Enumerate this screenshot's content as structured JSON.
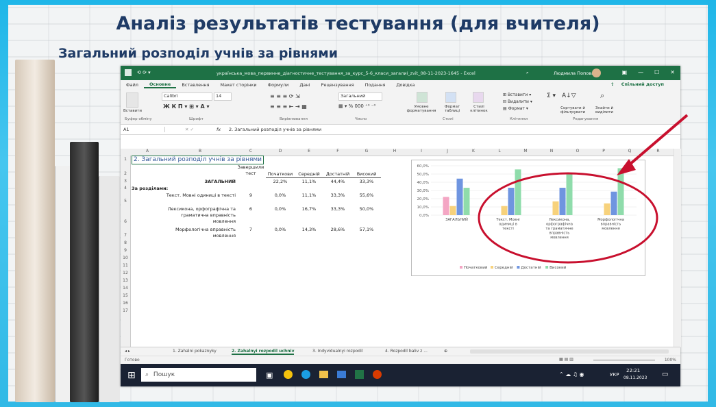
{
  "slide": {
    "title": "Аналіз результатів тестування (для вчителя)",
    "subtitle": "Загальний розподіл учнів за рівнями"
  },
  "excel": {
    "filename": "українська_мова_первинне_діагностичне_тестування_за_курс_5-6_класи_загалиі_zvit_08-11-2023-1645 - Excel",
    "user": "Людмила Попова",
    "menu": [
      "Файл",
      "Основне",
      "Вставлення",
      "Макет сторінки",
      "Формули",
      "Дані",
      "Рецензування",
      "Подання",
      "Довідка"
    ],
    "active_menu": "Основне",
    "share_label": "Спільний доступ",
    "ribbon": {
      "paste": "Вставити",
      "clipboard": "Буфер обміну",
      "font_name": "Calibri",
      "font_size": "14",
      "font_group": "Шрифт",
      "align_group": "Вирівнювання",
      "number_format": "Загальний",
      "number_group": "Число",
      "cond_format": "Умовне форматування",
      "format_table": "Формат таблиці",
      "cell_styles": "Стилі клітинок",
      "styles_group": "Стилі",
      "insert": "Вставити",
      "delete": "Видалити",
      "format": "Формат",
      "cells_group": "Клітинки",
      "sort": "Сортувати й фільтрувати",
      "find": "Знайти й виділити",
      "edit_group": "Редагування"
    },
    "namebox": "A1",
    "formula": "2. Загальний розподіл учнів за рівнями",
    "columns": [
      "A",
      "B",
      "C",
      "D",
      "E",
      "F",
      "G",
      "H",
      "I",
      "J",
      "K",
      "L",
      "M",
      "N",
      "O",
      "P",
      "Q",
      "R"
    ],
    "rows": [
      "1",
      "2",
      "3",
      "4",
      "5",
      "6",
      "7",
      "8",
      "9",
      "10",
      "11",
      "12",
      "13",
      "14",
      "15",
      "16",
      "17"
    ],
    "table": {
      "a1": "2. Загальний розподіл учнів за рівнями",
      "headers": [
        "Завершили тест",
        "Початкови",
        "Середній",
        "Достатній",
        "Високий"
      ],
      "general_label": "ЗАГАЛЬНИЙ",
      "general": [
        "",
        "22,2%",
        "11,1%",
        "44,4%",
        "33,3%"
      ],
      "sections_label": "За розділами:",
      "sections": [
        {
          "name": "Текст. Мовні одиниці в тексті",
          "values": [
            "9",
            "0,0%",
            "11,1%",
            "33,3%",
            "55,6%"
          ]
        },
        {
          "name": "Лексикона, орфографічна та граматична вправність мовлення",
          "values": [
            "6",
            "0,0%",
            "16,7%",
            "33,3%",
            "50,0%"
          ]
        },
        {
          "name": "Морфологічна вправність мовлення",
          "values": [
            "7",
            "0,0%",
            "14,3%",
            "28,6%",
            "57,1%"
          ]
        }
      ]
    },
    "sheet_tabs": [
      "1. Zahalni pokaznyky",
      "2. Zahalnyi rozpodil uchniv",
      "3. Indyvidualnyi rozpodil",
      "4. Rozpodil baliv z ..."
    ],
    "active_tab": "2. Zahalnyi rozpodil uchniv",
    "status_ready": "Готово",
    "zoom": "100%",
    "taskbar": {
      "search": "Пошук",
      "lang": "УКР",
      "time": "22:21",
      "date": "08.11.2023"
    }
  },
  "chart_data": {
    "type": "bar",
    "categories": [
      "ЗАГАЛЬНИЙ",
      "Текст. Мовні одиниці в тексті",
      "Лексикона, орфографічна та граматичне вправність мовлення",
      "Морфологічна вправність мовлення"
    ],
    "series": [
      {
        "name": "Початковий",
        "values": [
          22.2,
          0.0,
          0.0,
          0.0
        ],
        "color": "#f4a6c4"
      },
      {
        "name": "Середній",
        "values": [
          11.1,
          11.1,
          16.7,
          14.3
        ],
        "color": "#f7d27c"
      },
      {
        "name": "Достатній",
        "values": [
          44.4,
          33.3,
          33.3,
          28.6
        ],
        "color": "#6f95e0"
      },
      {
        "name": "Високий",
        "values": [
          33.3,
          55.6,
          50.0,
          57.1
        ],
        "color": "#8fdcab"
      }
    ],
    "ylim": [
      0,
      60
    ],
    "yticks": [
      "0,0%",
      "10,0%",
      "20,0%",
      "30,0%",
      "40,0%",
      "50,0%",
      "60,0%"
    ],
    "legend_position": "bottom"
  },
  "colors": {
    "excel_green": "#1e7145",
    "annotation_red": "#c8102e",
    "title_blue": "#1f3b66"
  }
}
